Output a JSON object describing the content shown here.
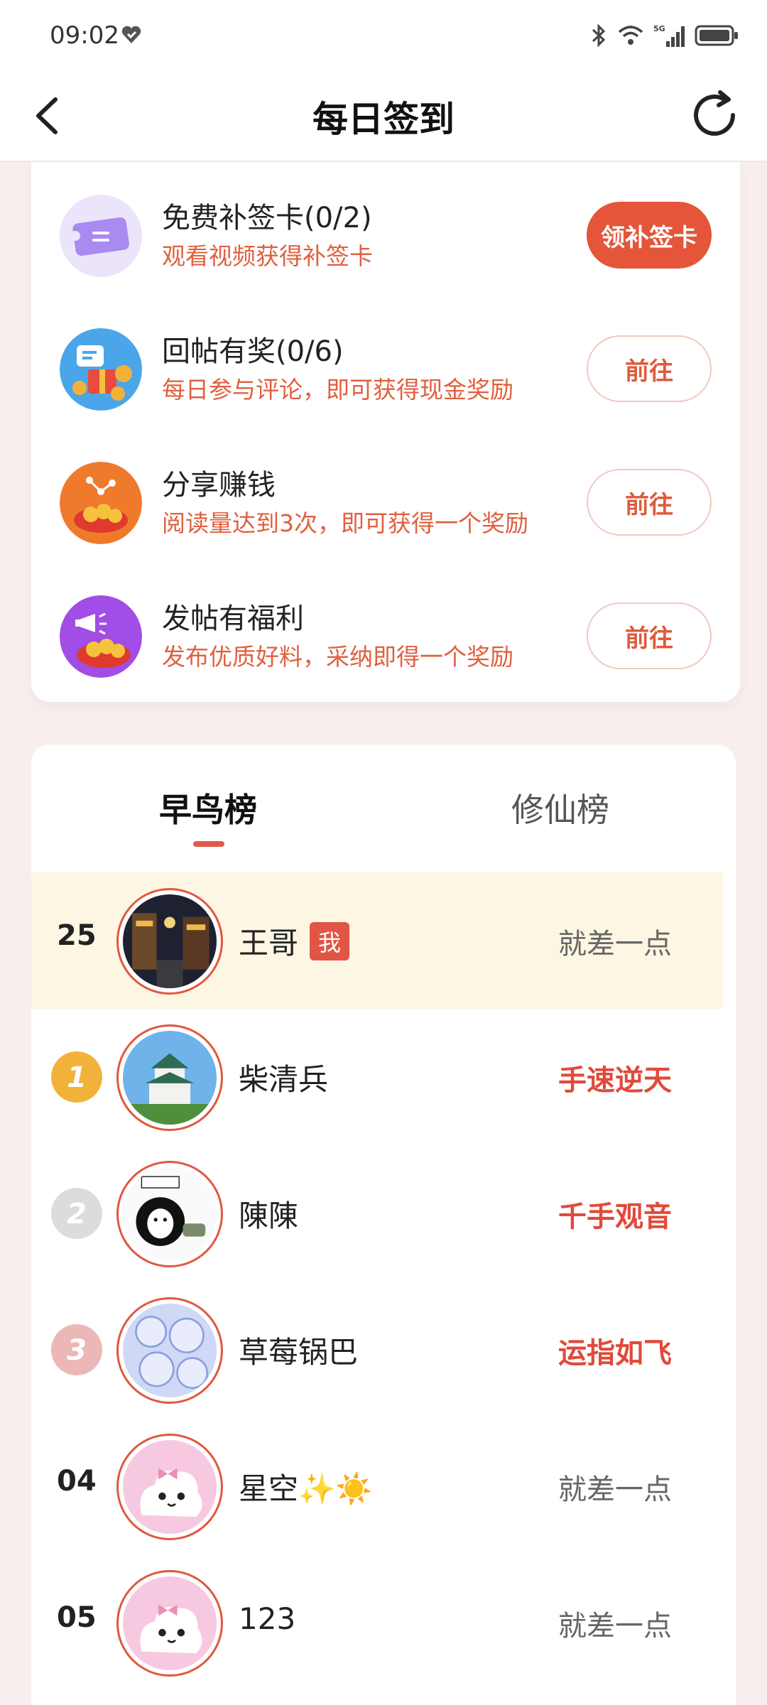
{
  "status_bar": {
    "time": "09:02",
    "icons": [
      "heart-shield-icon",
      "bluetooth-icon",
      "wifi-icon",
      "5g-signal-icon",
      "battery-icon"
    ]
  },
  "header": {
    "title": "每日签到"
  },
  "tasks": [
    {
      "title": "免费补签卡(0/2)",
      "desc": "观看视频获得补签卡",
      "button": "领补签卡",
      "icon": "ticket-icon"
    },
    {
      "title": "回帖有奖(0/6)",
      "desc": "每日参与评论，即可获得现金奖励",
      "button": "前往",
      "icon": "comment-gift-icon"
    },
    {
      "title": "分享赚钱",
      "desc": "阅读量达到3次，即可获得一个奖励",
      "button": "前往",
      "icon": "share-coins-icon"
    },
    {
      "title": "发帖有福利",
      "desc": "发布优质好料，采纳即得一个奖励",
      "button": "前往",
      "icon": "post-megaphone-icon"
    }
  ],
  "leaderboard": {
    "tabs": [
      "早鸟榜",
      "修仙榜"
    ],
    "active_tab": "早鸟榜",
    "me_badge": "我",
    "rows": [
      {
        "rank": "25",
        "name": "王哥",
        "status": "就差一点",
        "is_me": true
      },
      {
        "rank": "1",
        "name": "柴清兵",
        "status": "手速逆天"
      },
      {
        "rank": "2",
        "name": "陳陳",
        "status": "千手观音"
      },
      {
        "rank": "3",
        "name": "草莓锅巴",
        "status": "运指如飞"
      },
      {
        "rank": "04",
        "name": "星空✨☀️",
        "status": "就差一点"
      },
      {
        "rank": "05",
        "name": "123",
        "status": "就差一点"
      }
    ]
  },
  "colors": {
    "accent": "#e4553a",
    "hot_status": "#e04a3b",
    "desc_text": "#e0603f",
    "me_row_bg": "#fdf6e3",
    "gold": "#f2b23a",
    "silver": "#dcdcdc",
    "bronze": "#ebb7b7"
  }
}
